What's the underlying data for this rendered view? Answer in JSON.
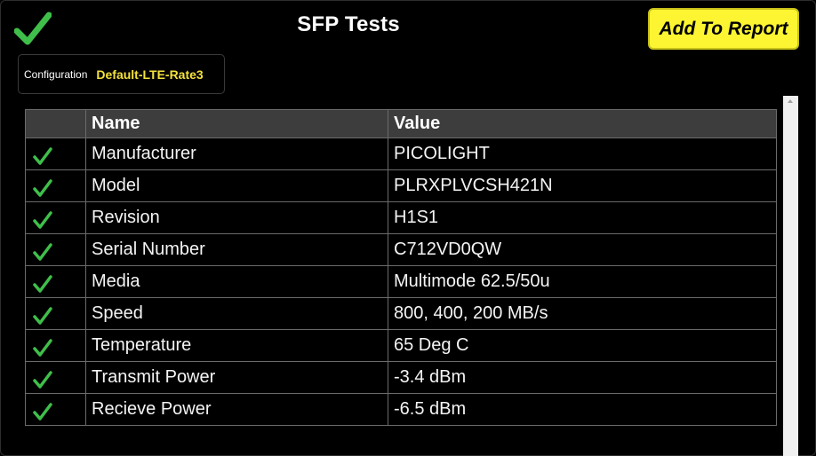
{
  "header": {
    "title": "SFP Tests",
    "status_icon": "checkmark-icon",
    "status_color": "#3fbf4a",
    "add_report_label": "Add To Report",
    "add_report_color": "#fdf531"
  },
  "configuration": {
    "label": "Configuration",
    "value": "Default-LTE-Rate3",
    "value_color": "#f3e23b"
  },
  "table": {
    "columns": [
      "",
      "Name",
      "Value"
    ],
    "rows": [
      {
        "status": "pass",
        "name": "Manufacturer",
        "value": "PICOLIGHT"
      },
      {
        "status": "pass",
        "name": "Model",
        "value": "PLRXPLVCSH421N"
      },
      {
        "status": "pass",
        "name": "Revision",
        "value": "H1S1"
      },
      {
        "status": "pass",
        "name": "Serial Number",
        "value": "C712VD0QW"
      },
      {
        "status": "pass",
        "name": "Media",
        "value": "Multimode 62.5/50u"
      },
      {
        "status": "pass",
        "name": "Speed",
        "value": "800, 400, 200 MB/s"
      },
      {
        "status": "pass",
        "name": "Temperature",
        "value": "65 Deg C"
      },
      {
        "status": "pass",
        "name": "Transmit Power",
        "value": "-3.4 dBm"
      },
      {
        "status": "pass",
        "name": "Recieve Power",
        "value": "-6.5 dBm"
      }
    ]
  }
}
